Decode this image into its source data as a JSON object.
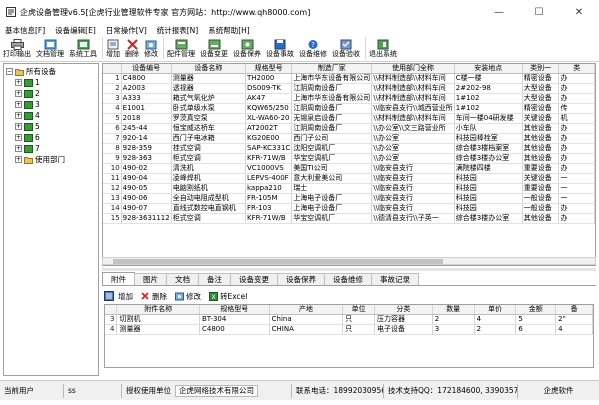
{
  "window": {
    "title": "企虎设备管理v6.5[企虎行业管理软件专家 官方网站：http://www.qh8000.com]",
    "minimize_glyph": "—",
    "maximize_glyph": "☐",
    "close_glyph": "✕"
  },
  "menu": [
    "基本信息[F]",
    "设备编辑[E]",
    "日常操作[V]",
    "统计报表[N]",
    "系统帮助[H]"
  ],
  "toolbar": [
    {
      "label": "打印输出",
      "icon": "printer-icon",
      "dropdown": true
    },
    {
      "label": "文档管理",
      "icon": "document-icon",
      "dropdown": true
    },
    {
      "label": "系统工具",
      "icon": "tools-icon",
      "dropdown": true
    },
    {
      "label": "增加",
      "icon": "add-icon"
    },
    {
      "label": "删除",
      "icon": "delete-icon"
    },
    {
      "label": "修改",
      "icon": "edit-icon"
    },
    {
      "label": "配件管理",
      "icon": "parts-icon"
    },
    {
      "label": "设备变更",
      "icon": "change-icon"
    },
    {
      "label": "设备保养",
      "icon": "maintain-icon"
    },
    {
      "label": "设备事故",
      "icon": "accident-icon"
    },
    {
      "label": "设备维修",
      "icon": "repair-icon"
    },
    {
      "label": "设备验收",
      "icon": "check-icon"
    },
    {
      "label": "退出系统",
      "icon": "exit-icon"
    }
  ],
  "tree": {
    "root": "所有设备",
    "nodes": [
      "1",
      "2",
      "3",
      "4",
      "5",
      "6",
      "7",
      "使用部门"
    ]
  },
  "grid": {
    "columns": [
      "",
      "设备编号",
      "设备名称",
      "规格型号",
      "制造厂家",
      "使用部门全称",
      "安装地点",
      "类别一",
      "类"
    ],
    "rows": [
      [
        "1",
        "C4800",
        "测量器",
        "TH2000",
        "上海市华东设备有限公司",
        "\\\\材料制造部\\\\材料车间",
        "C楼一楼",
        "精密设备",
        "办"
      ],
      [
        "2",
        "A2003",
        "透视器",
        "DS009-TK",
        "江阴周南设备厂",
        "\\\\材料制造部\\\\材料车间",
        "2#202-98",
        "大型设备",
        "办"
      ],
      [
        "3",
        "A333",
        "箱式气氧化炉",
        "AK47",
        "上海市华东设备有限公司",
        "\\\\材料制造部\\\\材料车间",
        "1#102",
        "大型设备",
        "办"
      ],
      [
        "4",
        "E1001",
        "卧式单级水泵",
        "KQW65/250",
        "江阴周南设备厂",
        "\\\\临安县支行\\\\城西营业所",
        "1#102",
        "精密设备",
        "传"
      ],
      [
        "5",
        "2018",
        "罗茨真空泵",
        "XL-WA60-20",
        "无锡泉启设备厂",
        "\\\\材料制造部\\\\材料车间",
        "车间一楼04研发楼",
        "关键设备",
        "机"
      ],
      [
        "6",
        "245-44",
        "恒宝威达桥车",
        "AT2002T",
        "江阴周南设备厂",
        "\\\\办公室\\\\文三路营业所",
        "小车队",
        "其他设备",
        "办"
      ],
      [
        "7",
        "920-14",
        "西门子电冰箱",
        "KG20E00",
        "西门子公司",
        "\\\\办公室",
        "科技园棒栓室",
        "其他设备",
        "办"
      ],
      [
        "8",
        "928-359",
        "挂式空调",
        "SAP-KC331C",
        "沈阳空调机厂",
        "\\\\办公室",
        "综合楼3楼档案室",
        "其他设备",
        "办"
      ],
      [
        "9",
        "928-363",
        "柜式空调",
        "KFR-71W/B",
        "华宝空调机厂",
        "\\\\办公室",
        "综合楼3楼办公室",
        "其他设备",
        "办"
      ],
      [
        "10",
        "490-02",
        "清洗机",
        "VC1000VS",
        "美国TI公司",
        "\\\\临安县支行",
        "满院楼四楼",
        "重要设备",
        "办"
      ],
      [
        "11",
        "490-04",
        "凌峰焊机",
        "LEPVS-400F",
        "意大利爱美公司",
        "\\\\临安县支行",
        "科技园",
        "关键设备",
        "一"
      ],
      [
        "12",
        "490-05",
        "电脑割纸机",
        "kappa210",
        "瑞士",
        "\\\\临安县支行",
        "科技园",
        "重要设备",
        "一"
      ],
      [
        "13",
        "490-06",
        "全自动电阻成型机",
        "FR-105M",
        "上海电子设备厂",
        "\\\\临安县支行",
        "科技园",
        "一般设备",
        "一"
      ],
      [
        "14",
        "490-07",
        "直线式数控电直钢机",
        "FR-103",
        "上海电子设备厂",
        "\\\\临安县支行",
        "科技园",
        "一般设备",
        "办"
      ],
      [
        "15",
        "928-3631112",
        "柜式空调",
        "KFR-71W/B",
        "华宝空调机厂",
        "\\\\德清县支行\\\\子英一",
        "综合楼3楼办公室",
        "其他设备",
        "办"
      ]
    ]
  },
  "tabs": [
    "附件",
    "图片",
    "文档",
    "备注",
    "设备变更",
    "设备保养",
    "设备维修",
    "事故记录"
  ],
  "active_tab": 0,
  "subtoolbar": [
    {
      "label": "增加",
      "icon": "add-icon"
    },
    {
      "label": "删除",
      "icon": "delete-icon"
    },
    {
      "label": "修改",
      "icon": "edit-icon"
    },
    {
      "label": "转Excel",
      "icon": "excel-icon"
    }
  ],
  "subgrid": {
    "columns": [
      "",
      "附件名称",
      "规格型号",
      "产地",
      "单位",
      "分类",
      "数量",
      "单价",
      "金额",
      "备"
    ],
    "rows": [
      [
        "3",
        "切割机",
        "BT-304",
        "China",
        "只",
        "压力容器",
        "2",
        "4",
        "5",
        "2\""
      ],
      [
        "4",
        "测量器",
        "C4800",
        "CHINA",
        "只",
        "电子设备",
        "3",
        "2",
        "6",
        "4"
      ]
    ]
  },
  "statusbar": {
    "current_user_label": "当前用户",
    "current_user_value": "ss",
    "license_label": "授权使用单位",
    "license_value": "企虎网络技术有限公司",
    "phone": "联系电话：18992030956",
    "qq": "技术支持QQ：172184600, 33903573",
    "brand": "企虎软件"
  },
  "colors": {
    "folder": "#e8c45a",
    "folder_green": "#3a9a3a",
    "delete_red": "#d42020",
    "accent_blue": "#2a6bc8"
  }
}
